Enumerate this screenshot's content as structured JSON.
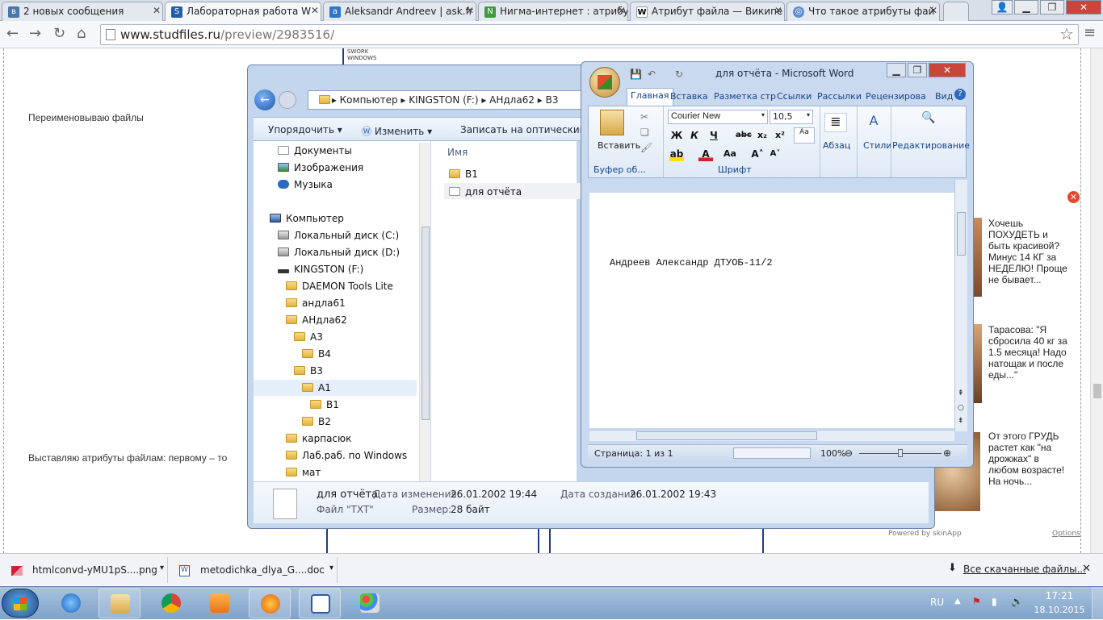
{
  "browser": {
    "tabs": [
      {
        "title": "2 новых сообщения",
        "fav": "vk-icon"
      },
      {
        "title": "Лабораторная работа W",
        "fav": "studfiles-icon"
      },
      {
        "title": "Aleksandr Andreev | ask.fr",
        "fav": "askfm-icon"
      },
      {
        "title": "Нигма-интернет : атрибу",
        "fav": "nigma-icon"
      },
      {
        "title": "Атрибут файла — Википе",
        "fav": "wikipedia-icon"
      },
      {
        "title": "Что такое атрибуты фай",
        "fav": "globe-icon"
      }
    ],
    "url_host": "www.studfiles.ru",
    "url_path": "/preview/2983516/"
  },
  "page": {
    "text1": "Переименовываю файлы",
    "text2": "Выставляю атрибуты файлам: первому – то",
    "thumb_top": "SWORK\nWINDOWS",
    "powered": "Powered by skinApp",
    "options": "Options"
  },
  "ads": [
    "Хочешь ПОХУДЕТЬ и быть красивой? Минус 14 КГ за НЕДЕЛЮ! Проще не бывает...",
    "Тарасова: \"Я сбросила 40 кг за 1.5 месяца! Надо натощак и после еды...\"",
    "От этого ГРУДЬ растет как \"на дрожжах\" в любом возрасте! На ночь..."
  ],
  "explorer": {
    "crumbs": [
      "Компьютер",
      "KINGSTON (F:)",
      "АНдла62",
      "B3"
    ],
    "toolbar": {
      "organize": "Упорядочить",
      "change": "Изменить",
      "burn": "Записать на оптический ди"
    },
    "tree": [
      {
        "label": "Документы",
        "icon": "documents-icon",
        "indent": 1
      },
      {
        "label": "Изображения",
        "icon": "pictures-icon",
        "indent": 1
      },
      {
        "label": "Музыка",
        "icon": "music-icon",
        "indent": 1
      },
      {
        "label": "Компьютер",
        "icon": "computer-icon",
        "indent": 0
      },
      {
        "label": "Локальный диск (C:)",
        "icon": "drive-icon",
        "indent": 1
      },
      {
        "label": "Локальный диск (D:)",
        "icon": "drive-icon",
        "indent": 1
      },
      {
        "label": "KINGSTON (F:)",
        "icon": "usb-drive-icon",
        "indent": 1
      },
      {
        "label": "DAEMON Tools Lite",
        "icon": "folder-icon",
        "indent": 2
      },
      {
        "label": "андла61",
        "icon": "folder-icon",
        "indent": 2
      },
      {
        "label": "АНдла62",
        "icon": "folder-icon",
        "indent": 2
      },
      {
        "label": "A3",
        "icon": "folder-icon",
        "indent": 3
      },
      {
        "label": "B4",
        "icon": "folder-icon",
        "indent": 4
      },
      {
        "label": "B3",
        "icon": "folder-icon",
        "indent": 3
      },
      {
        "label": "A1",
        "icon": "folder-icon",
        "indent": 4
      },
      {
        "label": "B1",
        "icon": "folder-icon",
        "indent": 5
      },
      {
        "label": "B2",
        "icon": "folder-icon",
        "indent": 4
      },
      {
        "label": "карпасюк",
        "icon": "folder-icon",
        "indent": 2
      },
      {
        "label": "Лаб.раб. по Windows",
        "icon": "folder-icon",
        "indent": 2
      },
      {
        "label": "мат",
        "icon": "folder-icon",
        "indent": 2
      }
    ],
    "column_name": "Имя",
    "files": [
      {
        "name": "B1",
        "icon": "folder-icon"
      },
      {
        "name": "для отчёта",
        "icon": "text-file-icon"
      }
    ],
    "details": {
      "name": "для отчёта",
      "modified_label": "Дата изменения:",
      "modified": "26.01.2002 19:44",
      "created_label": "Дата создания:",
      "created": "26.01.2002 19:43",
      "type": "Файл \"TXT\"",
      "size_label": "Размер:",
      "size": "28 байт"
    }
  },
  "word": {
    "title": "для отчёта - Microsoft Word",
    "tabs": [
      "Главная",
      "Вставка",
      "Разметка стр",
      "Ссылки",
      "Рассылки",
      "Рецензирова",
      "Вид"
    ],
    "paste": "Вставить",
    "clipboard": "Буфер об...",
    "font_name": "Courier New",
    "font_size": "10,5",
    "font_group": "Шрифт",
    "paragraph": "Абзац",
    "styles": "Стили",
    "editing": "Редактирование",
    "doc_text": "Андреев Александр ДТУОБ-11/2",
    "status_page": "Страница: 1 из 1",
    "zoom": "100%"
  },
  "downloads": {
    "items": [
      "htmlconvd-yMU1pS....png",
      "metodichka_dlya_G....doc"
    ],
    "all": "Все скачанные файлы..."
  },
  "taskbar": {
    "lang": "RU",
    "time": "17:21",
    "date": "18.10.2015"
  }
}
